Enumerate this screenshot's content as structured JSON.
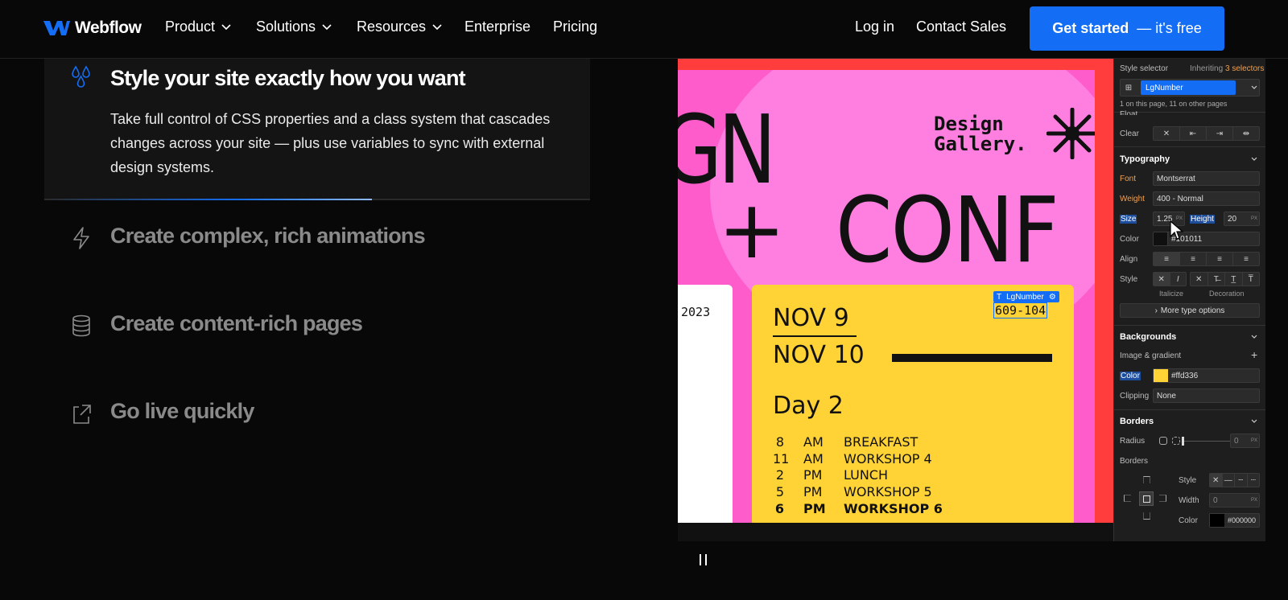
{
  "nav": {
    "logo": "Webflow",
    "items": [
      {
        "label": "Product",
        "has_dropdown": true
      },
      {
        "label": "Solutions",
        "has_dropdown": true
      },
      {
        "label": "Resources",
        "has_dropdown": true
      },
      {
        "label": "Enterprise",
        "has_dropdown": false
      },
      {
        "label": "Pricing",
        "has_dropdown": false
      }
    ],
    "login": "Log in",
    "contact": "Contact Sales",
    "cta_bold": "Get started",
    "cta_rest": "— it's free"
  },
  "features": [
    {
      "icon": "droplets-icon",
      "title": "Style your site exactly how you want",
      "description": "Take full control of CSS properties and a class system that cascades changes across your site — plus use variables to sync with external design systems.",
      "active": true,
      "progress": 0.6
    },
    {
      "icon": "lightning-icon",
      "title": "Create complex, rich animations",
      "active": false
    },
    {
      "icon": "database-icon",
      "title": "Create content-rich pages",
      "active": false
    },
    {
      "icon": "external-link-icon",
      "title": "Go live quickly",
      "active": false
    }
  ],
  "poster": {
    "headline_1": "GN",
    "headline_plus": "+",
    "headline_2": "CONF",
    "gallery_line1": "Design",
    "gallery_line2": "Gallery.",
    "year": "2023",
    "date_1": "NOV 9",
    "date_2": "NOV 10",
    "day": "Day 2",
    "selected_class": "LgNumber",
    "selected_value": "609-104",
    "schedule": [
      {
        "hour": "8",
        "ampm": "AM",
        "event": "BREAKFAST"
      },
      {
        "hour": "11",
        "ampm": "AM",
        "event": "WORKSHOP 4"
      },
      {
        "hour": "2",
        "ampm": "PM",
        "event": "LUNCH"
      },
      {
        "hour": "5",
        "ampm": "PM",
        "event": "WORKSHOP 5"
      },
      {
        "hour": "6",
        "ampm": "PM",
        "event": "WORKSHOP 6"
      }
    ]
  },
  "panel": {
    "style_selector": "Style selector",
    "inheriting_prefix": "Inheriting",
    "inheriting_count": "3 selectors",
    "selector": "LgNumber",
    "page_usage": "1 on this page, 11 on other pages",
    "float_label": "Float",
    "clear_label": "Clear",
    "typography": {
      "title": "Typography",
      "font_label": "Font",
      "font": "Montserrat",
      "weight_label": "Weight",
      "weight": "400 - Normal",
      "size_label": "Size",
      "size": "1.25",
      "size_unit": "PX",
      "height_label": "Height",
      "height": "20",
      "height_unit": "PX",
      "color_label": "Color",
      "color": "#101011",
      "align_label": "Align",
      "style_label": "Style",
      "italicize": "Italicize",
      "decoration": "Decoration",
      "more": "More type options"
    },
    "backgrounds": {
      "title": "Backgrounds",
      "image_gradient": "Image & gradient",
      "color_label": "Color",
      "color": "#ffd336",
      "clipping_label": "Clipping",
      "clipping": "None"
    },
    "borders": {
      "title": "Borders",
      "radius_label": "Radius",
      "radius": "0",
      "radius_unit": "PX",
      "borders_label": "Borders",
      "style_label": "Style",
      "width_label": "Width",
      "width": "0",
      "width_unit": "PX",
      "color_label": "Color",
      "color": "#000000"
    }
  },
  "colors": {
    "accent": "#146ef5",
    "poster_red": "#ff3d3d",
    "poster_pink": "#ff5ccb",
    "poster_yellow": "#ffd336"
  }
}
